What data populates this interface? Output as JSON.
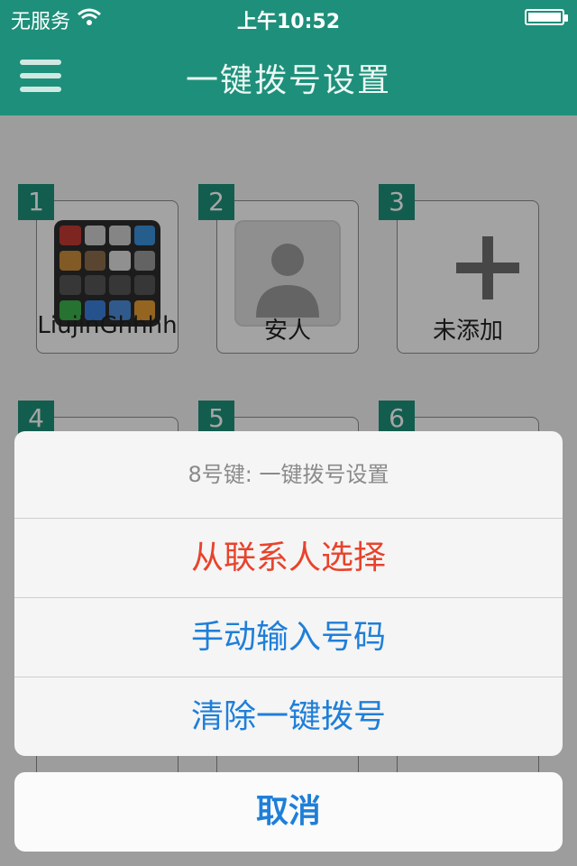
{
  "status_bar": {
    "carrier": "无服务",
    "time": "上午10:52",
    "battery_level": 1.0
  },
  "nav": {
    "title": "一键拨号设置",
    "menu_icon": "menu-icon"
  },
  "slots": [
    {
      "number": "1",
      "label": "LiujinGhhhh",
      "icon": "home-screen-thumbnail"
    },
    {
      "number": "2",
      "label": "安人",
      "icon": "person-silhouette-icon"
    },
    {
      "number": "3",
      "label": "未添加",
      "icon": "plus-icon"
    },
    {
      "number": "4"
    },
    {
      "number": "5"
    },
    {
      "number": "6"
    }
  ],
  "action_sheet": {
    "title": "8号键: 一键拨号设置",
    "options": [
      {
        "label": "从联系人选择",
        "color": "#e8432c"
      },
      {
        "label": "手动输入号码",
        "color": "#1f7fd8"
      },
      {
        "label": "清除一键拨号",
        "color": "#1f7fd8"
      }
    ],
    "cancel": "取消"
  },
  "colors": {
    "brand": "#1e8f7a",
    "destructive": "#e8432c",
    "action": "#1f7fd8"
  }
}
